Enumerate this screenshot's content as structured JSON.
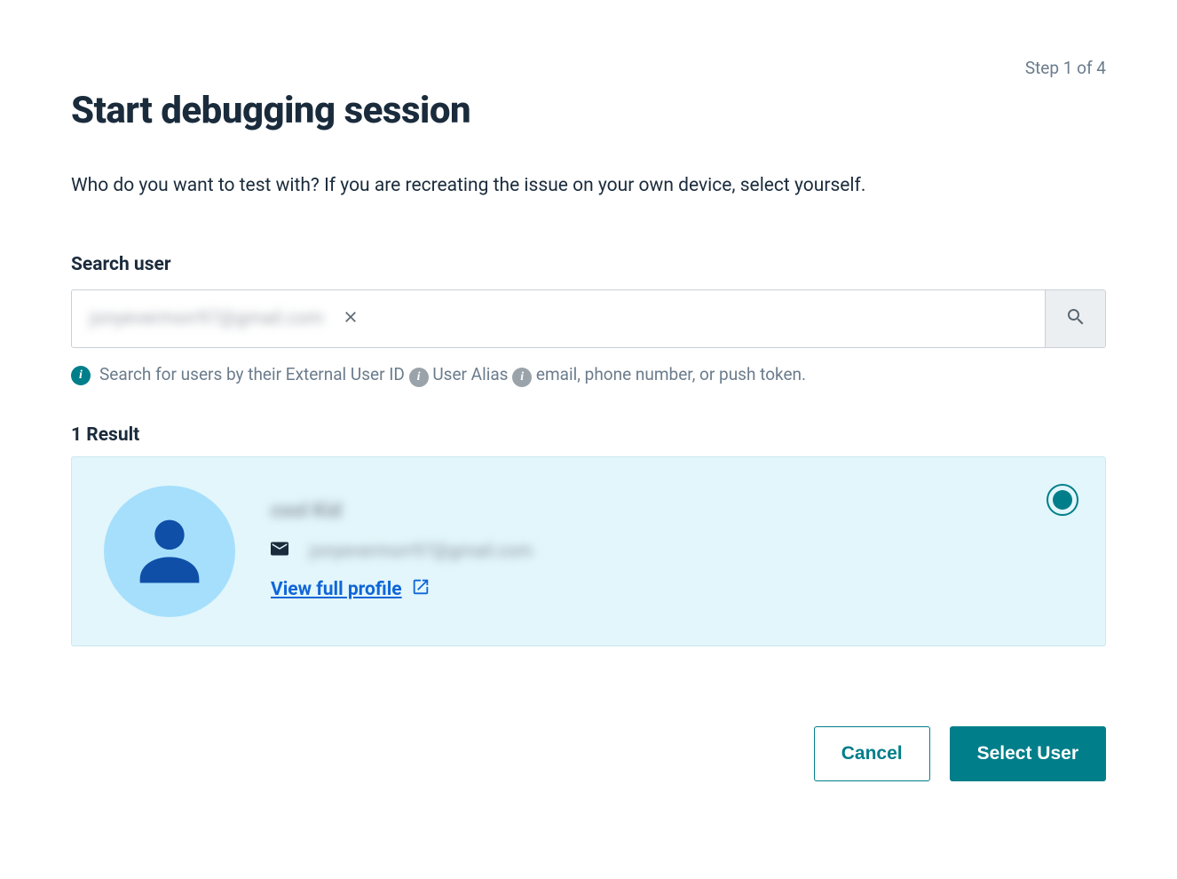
{
  "step_indicator": "Step 1 of 4",
  "page_title": "Start debugging session",
  "description": "Who do you want to test with? If you are recreating the issue on your own device, select yourself.",
  "search": {
    "label": "Search user",
    "value": "jonyevermorr97@gmail.com",
    "hint_prefix": "Search for users by their External User ID",
    "hint_user_alias": "User Alias",
    "hint_suffix": "email, phone number, or push token."
  },
  "results": {
    "label": "1 Result",
    "items": [
      {
        "name": "cool Kid",
        "email": "jonyevermorr97@gmail.com",
        "profile_link_label": "View full profile",
        "selected": true
      }
    ]
  },
  "buttons": {
    "cancel": "Cancel",
    "select_user": "Select User"
  }
}
